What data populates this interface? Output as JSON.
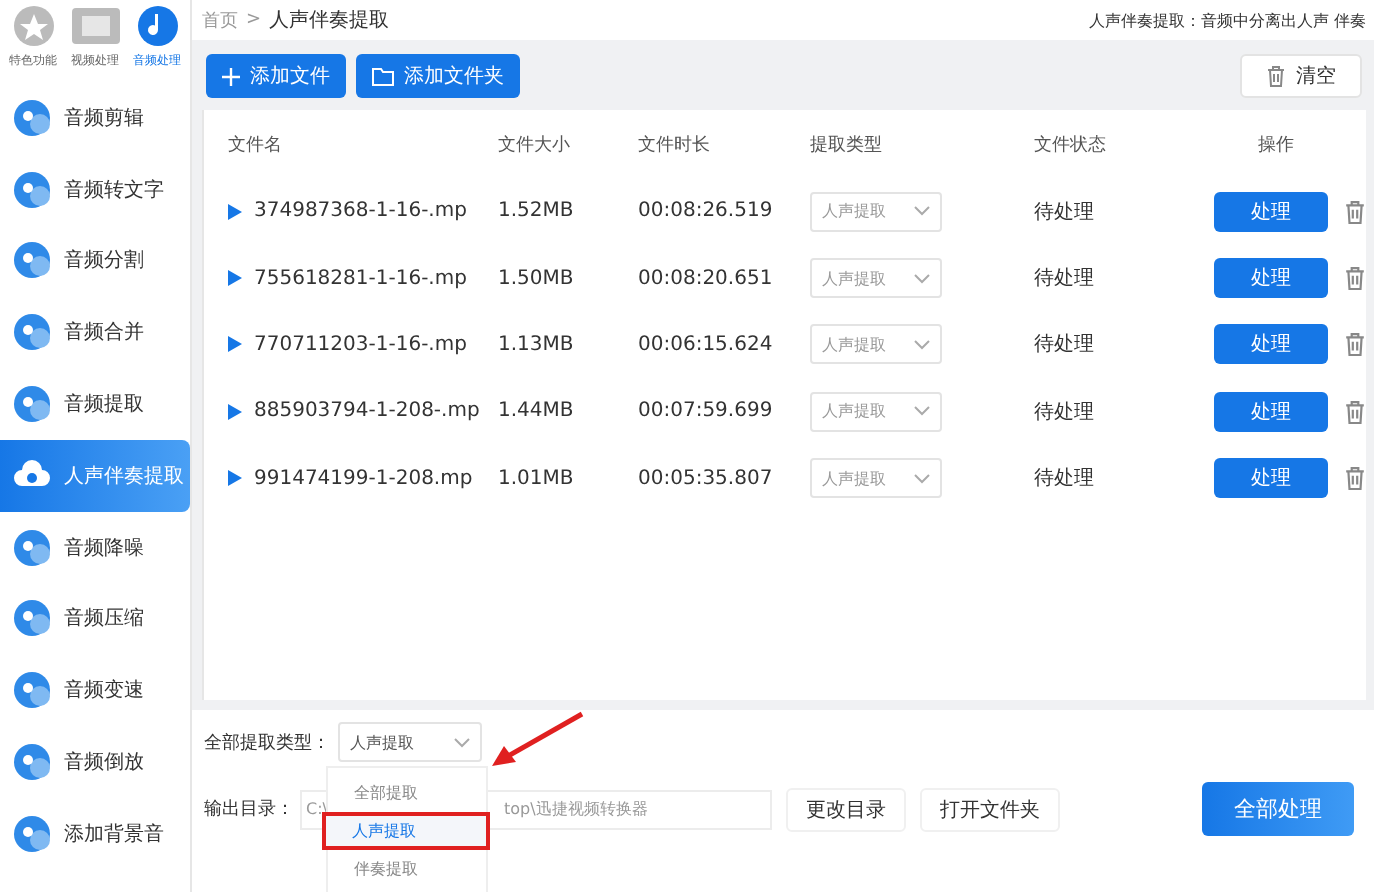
{
  "top_tabs": [
    {
      "label": "特色功能",
      "selected": false
    },
    {
      "label": "视频处理",
      "selected": false
    },
    {
      "label": "音频处理",
      "selected": true
    }
  ],
  "sidebar": {
    "items": [
      {
        "label": "音频剪辑",
        "selected": false
      },
      {
        "label": "音频转文字",
        "selected": false
      },
      {
        "label": "音频分割",
        "selected": false
      },
      {
        "label": "音频合并",
        "selected": false
      },
      {
        "label": "音频提取",
        "selected": false
      },
      {
        "label": "人声伴奏提取",
        "selected": true
      },
      {
        "label": "音频降噪",
        "selected": false
      },
      {
        "label": "音频压缩",
        "selected": false
      },
      {
        "label": "音频变速",
        "selected": false
      },
      {
        "label": "音频倒放",
        "selected": false
      },
      {
        "label": "添加背景音",
        "selected": false
      }
    ]
  },
  "breadcrumb": [
    "首页",
    "人声伴奏提取"
  ],
  "breadcrumb_separator": ">",
  "description": "人声伴奏提取：音频中分离出人声 伴奏",
  "toolbar": {
    "add_file": "添加文件",
    "add_folder": "添加文件夹",
    "clear": "清空"
  },
  "table": {
    "columns": [
      "文件名",
      "文件大小",
      "文件时长",
      "提取类型",
      "文件状态",
      "操作"
    ],
    "rows": [
      {
        "name": "374987368-1-16-.mp",
        "size": "1.52MB",
        "duration": "00:08:26.519",
        "type": "人声提取",
        "status": "待处理",
        "action": "处理"
      },
      {
        "name": "755618281-1-16-.mp",
        "size": "1.50MB",
        "duration": "00:08:20.651",
        "type": "人声提取",
        "status": "待处理",
        "action": "处理"
      },
      {
        "name": "770711203-1-16-.mp",
        "size": "1.13MB",
        "duration": "00:06:15.624",
        "type": "人声提取",
        "status": "待处理",
        "action": "处理"
      },
      {
        "name": "885903794-1-208-.mp",
        "size": "1.44MB",
        "duration": "00:07:59.699",
        "type": "人声提取",
        "status": "待处理",
        "action": "处理"
      },
      {
        "name": "991474199-1-208.mp",
        "size": "1.01MB",
        "duration": "00:05:35.807",
        "type": "人声提取",
        "status": "待处理",
        "action": "处理"
      }
    ]
  },
  "footer": {
    "type_label": "全部提取类型：",
    "type_value": "人声提取",
    "type_options": [
      {
        "label": "全部提取",
        "selected": false
      },
      {
        "label": "人声提取",
        "selected": true
      },
      {
        "label": "伴奏提取",
        "selected": false
      }
    ],
    "output_label": "输出目录：",
    "output_path_start": "C:\\",
    "output_path_end": "top\\迅捷视频转换器",
    "change_dir": "更改目录",
    "open_folder": "打开文件夹",
    "process_all": "全部处理"
  }
}
